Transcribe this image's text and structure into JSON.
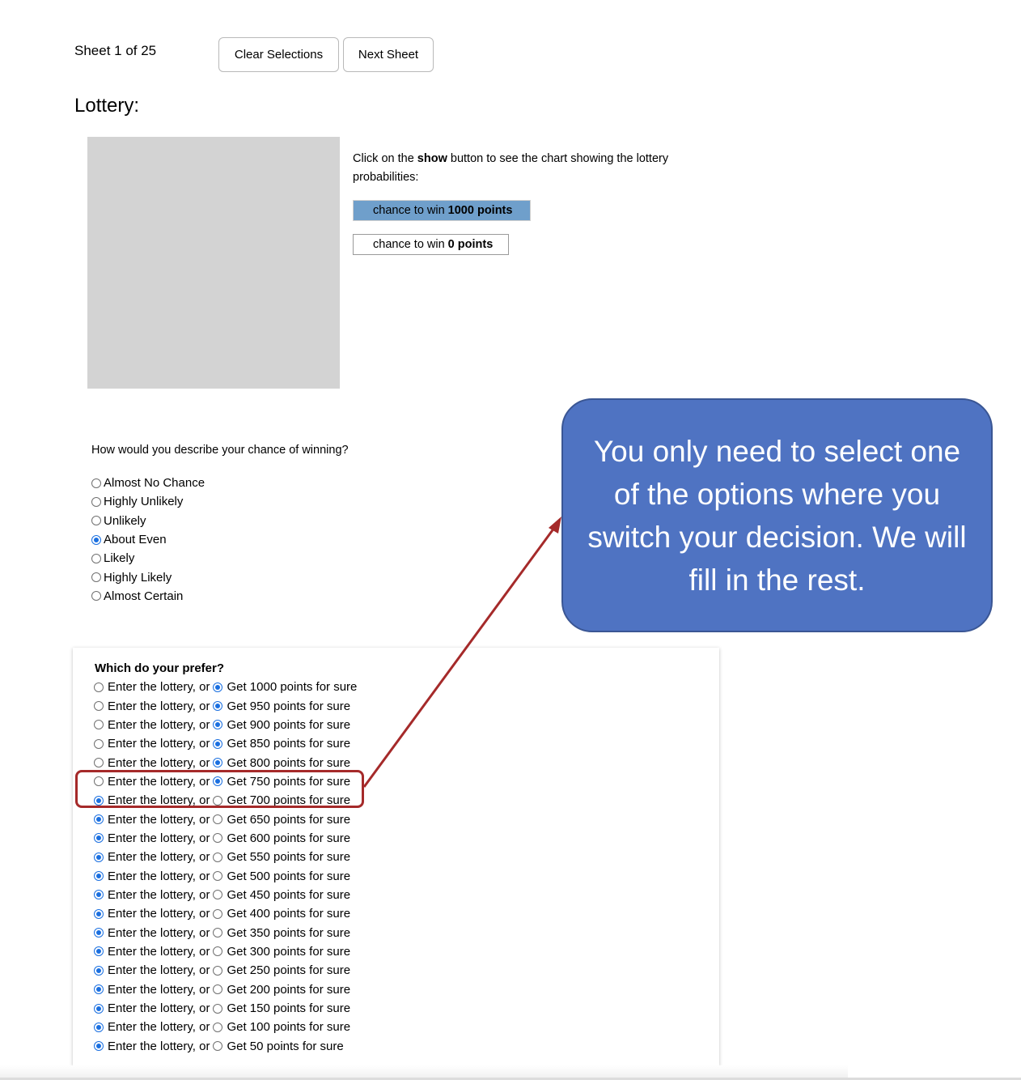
{
  "header": {
    "sheet_label": "Sheet 1 of 25",
    "clear_button": "Clear Selections",
    "next_button": "Next Sheet"
  },
  "title": "Lottery:",
  "instructions": {
    "pre": "Click on the ",
    "bold": "show",
    "post": " button to see the chart showing the lottery probabilities:"
  },
  "probabilities": [
    {
      "prefix": "chance to win",
      "amount": "1000 points",
      "color": "#6f9fcb"
    },
    {
      "prefix": "chance to win",
      "amount": "0 points",
      "color": "#ffffff"
    }
  ],
  "chance_question": "How would you describe your chance of winning?",
  "chance_options": [
    {
      "label": "Almost No Chance",
      "selected": false
    },
    {
      "label": "Highly Unlikely",
      "selected": false
    },
    {
      "label": "Unlikely",
      "selected": false
    },
    {
      "label": "About Even",
      "selected": true
    },
    {
      "label": "Likely",
      "selected": false
    },
    {
      "label": "Highly Likely",
      "selected": false
    },
    {
      "label": "Almost Certain",
      "selected": false
    }
  ],
  "preference": {
    "title": "Which do your prefer?",
    "rows": [
      {
        "lottery": "Enter the lottery, or",
        "sure": "Get 1000 points for sure",
        "choice": "sure"
      },
      {
        "lottery": "Enter the lottery, or",
        "sure": "Get 950 points for sure",
        "choice": "sure"
      },
      {
        "lottery": "Enter the lottery, or",
        "sure": "Get 900 points for sure",
        "choice": "sure"
      },
      {
        "lottery": "Enter the lottery, or",
        "sure": "Get 850 points for sure",
        "choice": "sure"
      },
      {
        "lottery": "Enter the lottery, or",
        "sure": "Get 800 points for sure",
        "choice": "sure"
      },
      {
        "lottery": "Enter the lottery, or",
        "sure": "Get 750 points for sure",
        "choice": "sure"
      },
      {
        "lottery": "Enter the lottery, or",
        "sure": "Get 700 points for sure",
        "choice": "lottery"
      },
      {
        "lottery": "Enter the lottery, or",
        "sure": "Get 650 points for sure",
        "choice": "lottery"
      },
      {
        "lottery": "Enter the lottery, or",
        "sure": "Get 600 points for sure",
        "choice": "lottery"
      },
      {
        "lottery": "Enter the lottery, or",
        "sure": "Get 550 points for sure",
        "choice": "lottery"
      },
      {
        "lottery": "Enter the lottery, or",
        "sure": "Get 500 points for sure",
        "choice": "lottery"
      },
      {
        "lottery": "Enter the lottery, or",
        "sure": "Get 450 points for sure",
        "choice": "lottery"
      },
      {
        "lottery": "Enter the lottery, or",
        "sure": "Get 400 points for sure",
        "choice": "lottery"
      },
      {
        "lottery": "Enter the lottery, or",
        "sure": "Get 350 points for sure",
        "choice": "lottery"
      },
      {
        "lottery": "Enter the lottery, or",
        "sure": "Get 300 points for sure",
        "choice": "lottery"
      },
      {
        "lottery": "Enter the lottery, or",
        "sure": "Get 250 points for sure",
        "choice": "lottery"
      },
      {
        "lottery": "Enter the lottery, or",
        "sure": "Get 200 points for sure",
        "choice": "lottery"
      },
      {
        "lottery": "Enter the lottery, or",
        "sure": "Get 150 points for sure",
        "choice": "lottery"
      },
      {
        "lottery": "Enter the lottery, or",
        "sure": "Get 100 points for sure",
        "choice": "lottery"
      },
      {
        "lottery": "Enter the lottery, or",
        "sure": "Get 50 points for sure",
        "choice": "lottery"
      }
    ]
  },
  "callout": {
    "text": "You only need to select one of the options where you switch your decision. We will fill in the rest.",
    "color": "#4f73c2"
  },
  "annotation_color": "#a52a2a"
}
